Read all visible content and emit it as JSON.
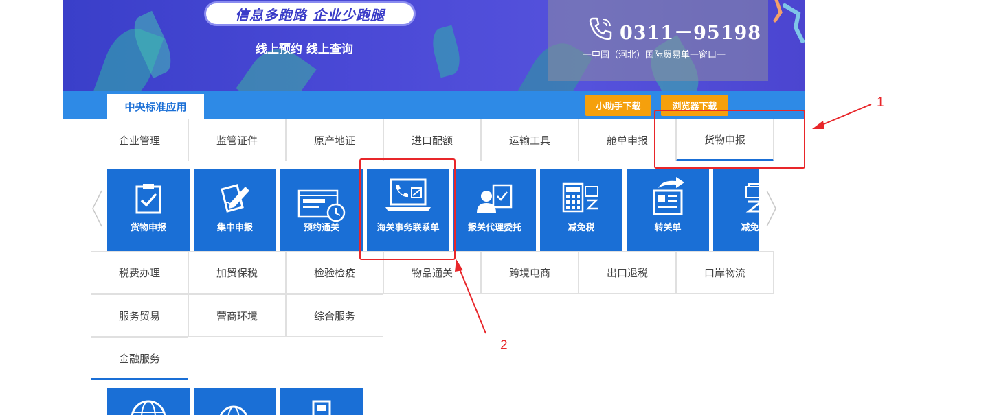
{
  "banner": {
    "slogan": "信息多跑路 企业少跑腿",
    "subslogan": "线上预约  线上查询",
    "phone_number": "0311－95198",
    "phone_caption": "一中国（河北）国际贸易单一窗口一"
  },
  "tabbar": {
    "central_tab": "中央标准应用",
    "helper_download": "小助手下载",
    "browser_download": "浏览器下载"
  },
  "categories_row1": [
    "企业管理",
    "监管证件",
    "原产地证",
    "进口配额",
    "运输工具",
    "舱单申报",
    "货物申报"
  ],
  "tiles": [
    {
      "label": "货物申报",
      "icon": "clipboard-check-icon"
    },
    {
      "label": "集中申报",
      "icon": "pen-document-icon"
    },
    {
      "label": "预约通关",
      "icon": "browser-clock-icon"
    },
    {
      "label": "海关事务联系单",
      "icon": "laptop-phone-icon"
    },
    {
      "label": "报关代理委托",
      "icon": "agent-document-icon"
    },
    {
      "label": "减免税",
      "icon": "calculator-yen-icon"
    },
    {
      "label": "转关单",
      "icon": "document-forward-icon"
    },
    {
      "label": "减免税",
      "icon": "yen-document-icon"
    }
  ],
  "categories_row2": [
    "税费办理",
    "加贸保税",
    "检验检疫",
    "物品通关",
    "跨境电商",
    "出口退税",
    "口岸物流"
  ],
  "categories_row3": [
    "服务贸易",
    "营商环境",
    "综合服务"
  ],
  "categories_row4": [
    "金融服务"
  ],
  "annotations": {
    "label_1": "1",
    "label_2": "2"
  },
  "colors": {
    "primary_blue": "#1a6fd6",
    "bar_blue": "#2e8ae6",
    "orange": "#f5a00c",
    "annotation_red": "#e8262a"
  }
}
